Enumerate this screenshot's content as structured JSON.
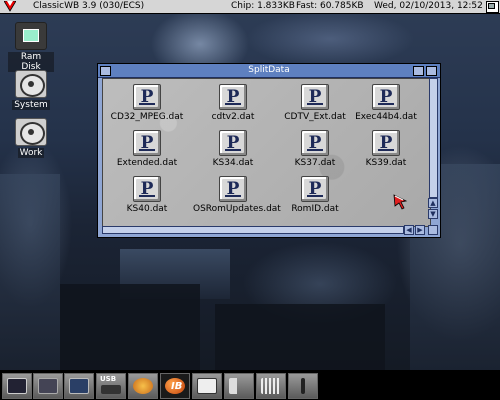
{
  "topbar": {
    "title": "ClassicWB 3.9 (030/ECS)",
    "chip": "Chip: 1.833KB",
    "fast": "Fast: 60.785KB",
    "datetime": "Wed, 02/10/2013, 12:52"
  },
  "desktop_icons": [
    {
      "label": "Ram Disk",
      "icon": "ramdisk-icon"
    },
    {
      "label": "System",
      "icon": "harddisk-icon"
    },
    {
      "label": "Work",
      "icon": "harddisk-icon"
    }
  ],
  "window": {
    "title": "SplitData",
    "files": [
      {
        "label": "CD32_MPEG.dat"
      },
      {
        "label": "cdtv2.dat"
      },
      {
        "label": "CDTV_Ext.dat"
      },
      {
        "label": "Exec44b4.dat"
      },
      {
        "label": "Extended.dat"
      },
      {
        "label": "KS34.dat"
      },
      {
        "label": "KS37.dat"
      },
      {
        "label": "KS39.dat"
      },
      {
        "label": "KS40.dat"
      },
      {
        "label": "OSRomUpdates.dat"
      },
      {
        "label": "RomID.dat"
      }
    ]
  },
  "dock": {
    "usb_label": "USB",
    "ib_label": "IB",
    "items": [
      "display-icon",
      "video-icon",
      "screen-icon",
      "usb-icon",
      "beach-icon",
      "ibrowse-icon",
      "envelope-icon",
      "speaker-icon",
      "sound-icon",
      "joystick-icon"
    ]
  },
  "colors": {
    "window_title_bar": "#5e80c0",
    "window_frame": "#8fa6d4",
    "topbar": "#d6d6d6",
    "pointer": "#e02020"
  }
}
